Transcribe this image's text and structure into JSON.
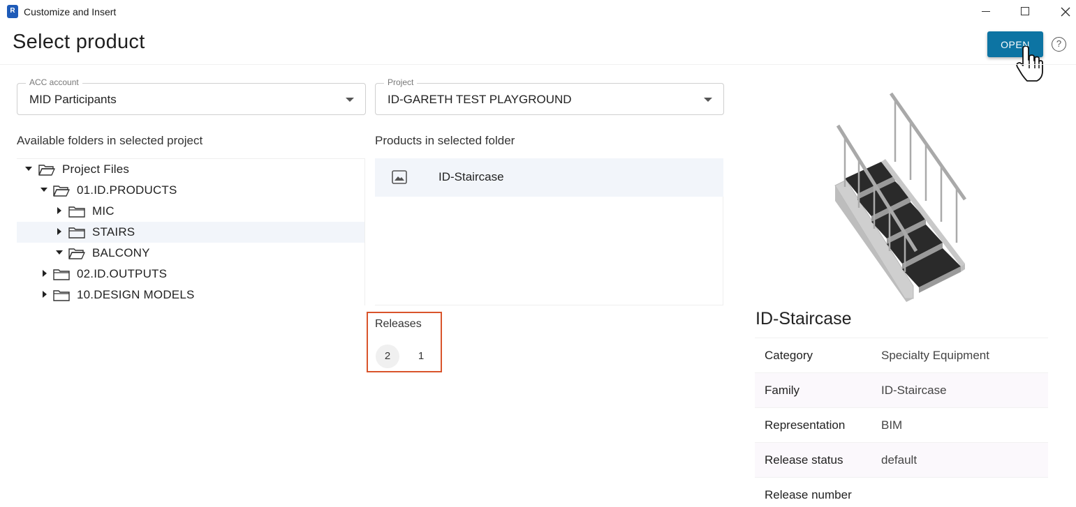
{
  "window": {
    "title": "Customize and Insert",
    "app_icon_letter": "R"
  },
  "header": {
    "title": "Select product",
    "open_label": "OPEN",
    "help_symbol": "?"
  },
  "selects": {
    "account": {
      "label": "ACC account",
      "value": "MID Participants"
    },
    "project": {
      "label": "Project",
      "value": "ID-GARETH TEST PLAYGROUND"
    }
  },
  "folders": {
    "heading": "Available folders in selected project",
    "items": [
      {
        "label": "Project Files",
        "expanded": true,
        "selected": false
      },
      {
        "label": "01.ID.PRODUCTS",
        "expanded": true,
        "selected": false
      },
      {
        "label": "MIC",
        "expanded": false,
        "selected": false
      },
      {
        "label": "STAIRS",
        "expanded": false,
        "selected": true
      },
      {
        "label": "BALCONY",
        "expanded": true,
        "selected": false
      },
      {
        "label": "02.ID.OUTPUTS",
        "expanded": false,
        "selected": false
      },
      {
        "label": "10.DESIGN MODELS",
        "expanded": false,
        "selected": false
      }
    ]
  },
  "products": {
    "heading": "Products in selected folder",
    "items": [
      {
        "name": "ID-Staircase",
        "thumbnail_icon": "image-icon"
      }
    ]
  },
  "releases": {
    "title": "Releases",
    "items": [
      {
        "label": "2",
        "active": true
      },
      {
        "label": "1",
        "active": false
      }
    ]
  },
  "details": {
    "title": "ID-Staircase",
    "rows": [
      {
        "key": "Category",
        "value": "Specialty Equipment"
      },
      {
        "key": "Family",
        "value": "ID-Staircase"
      },
      {
        "key": "Representation",
        "value": "BIM"
      },
      {
        "key": "Release status",
        "value": "default"
      },
      {
        "key": "Release number",
        "value": ""
      }
    ]
  },
  "colors": {
    "accent": "#0d74a3",
    "highlight_box": "#d9542b",
    "selected_row": "#f2f5fa"
  },
  "icons": {
    "cursor": "hand-pointer-icon",
    "folder_open": "folder-open-icon",
    "folder": "folder-icon"
  }
}
